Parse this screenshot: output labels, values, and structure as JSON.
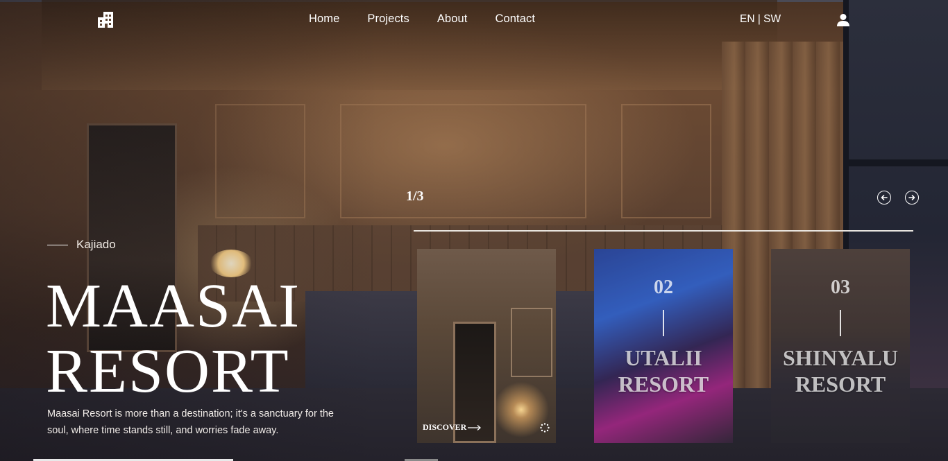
{
  "nav": {
    "logo_icon": "building-icon",
    "links": [
      "Home",
      "Projects",
      "About",
      "Contact"
    ],
    "language": "EN | SW",
    "user_icon": "user-icon"
  },
  "hero": {
    "location": "Kajiado",
    "title_line1": "MAASAI",
    "title_line2": "RESORT",
    "description": "Maasai Resort is more than a destination; it's a sanctuary for the soul, where time stands still, and worries fade away."
  },
  "slider": {
    "counter": "1/3",
    "prev_icon": "arrow-left-circle-icon",
    "next_icon": "arrow-right-circle-icon",
    "cards": [
      {
        "discover_label": "DISCOVER",
        "discover_icon": "arrow-right-icon",
        "loader_icon": "spinner-icon"
      },
      {
        "number": "02",
        "name_line1": "UTALII",
        "name_line2": "RESORT"
      },
      {
        "number": "03",
        "name_line1": "SHINYALU",
        "name_line2": "RESORT"
      }
    ]
  },
  "colors": {
    "text": "#ffffff",
    "accent_line": "#e8e4de"
  }
}
